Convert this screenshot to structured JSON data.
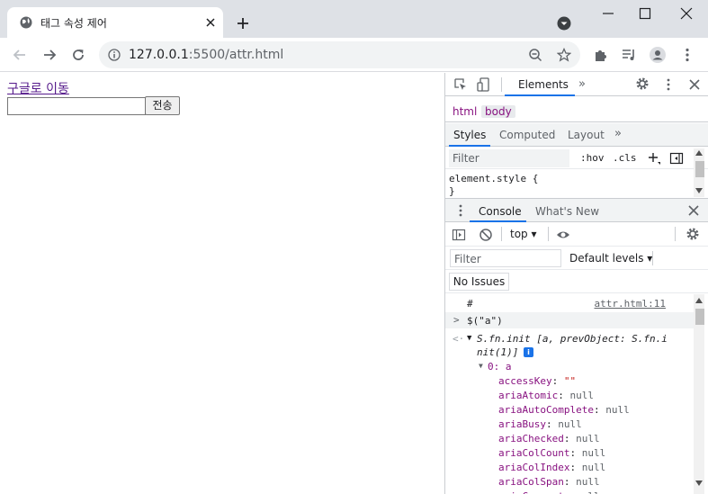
{
  "browser": {
    "tab_title": "태그 속성 제어",
    "url_host": "127.0.0.1",
    "url_rest": ":5500/attr.html"
  },
  "page": {
    "link_text": "구글로 이동",
    "input_value": "",
    "submit_label": "전송"
  },
  "devtools": {
    "main_tab": "Elements",
    "more_tabs": "»",
    "breadcrumb": [
      "html",
      "body"
    ],
    "styles_tabs": [
      "Styles",
      "Computed",
      "Layout"
    ],
    "styles_filter_placeholder": "Filter",
    "hov_label": ":hov",
    "cls_label": ".cls",
    "element_style_open": "element.style {",
    "element_style_close": "}",
    "drawer_tabs": [
      "Console",
      "What's New"
    ],
    "context": "top",
    "console_filter_placeholder": "Filter",
    "levels_label": "Default levels",
    "issues_label": "No Issues",
    "log": {
      "hash_line": "#",
      "hash_source": "attr.html:11",
      "input_cmd": "$(\"a\")",
      "result_line1": "S.fn.init [a, prevObject: S.fn.i",
      "result_line2": "nit(1)]",
      "item_label": "0: a",
      "props": [
        {
          "name": "accessKey",
          "value": "\"\"",
          "kind": "str"
        },
        {
          "name": "ariaAtomic",
          "value": "null",
          "kind": "null"
        },
        {
          "name": "ariaAutoComplete",
          "value": "null",
          "kind": "null"
        },
        {
          "name": "ariaBusy",
          "value": "null",
          "kind": "null"
        },
        {
          "name": "ariaChecked",
          "value": "null",
          "kind": "null"
        },
        {
          "name": "ariaColCount",
          "value": "null",
          "kind": "null"
        },
        {
          "name": "ariaColIndex",
          "value": "null",
          "kind": "null"
        },
        {
          "name": "ariaColSpan",
          "value": "null",
          "kind": "null"
        },
        {
          "name": "ariaCurrent",
          "value": "null",
          "kind": "null"
        }
      ]
    }
  }
}
